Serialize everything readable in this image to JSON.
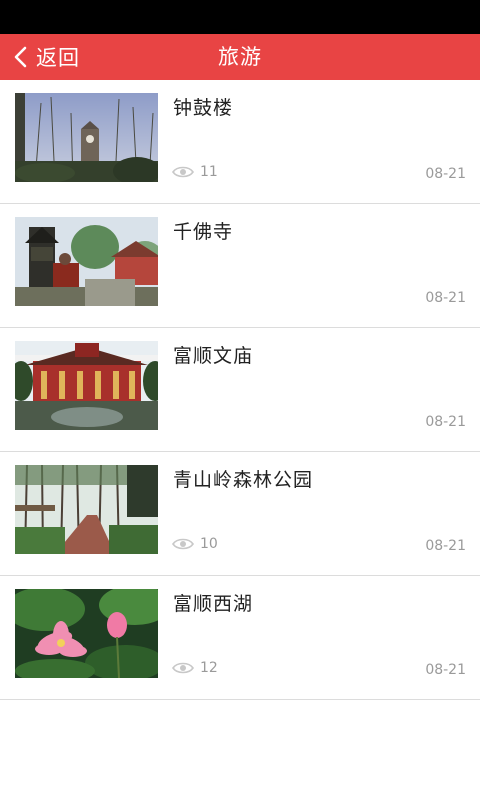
{
  "header": {
    "back_label": "返回",
    "title": "旅游",
    "accent_color": "#e84444"
  },
  "items": [
    {
      "title": "钟鼓楼",
      "views": "11",
      "date": "08-21",
      "image": "clock-tower-photo"
    },
    {
      "title": "千佛寺",
      "views": "",
      "date": "08-21",
      "image": "temple-incense-photo"
    },
    {
      "title": "富顺文庙",
      "views": "",
      "date": "08-21",
      "image": "confucius-temple-photo"
    },
    {
      "title": "青山岭森林公园",
      "views": "10",
      "date": "08-21",
      "image": "forest-path-photo"
    },
    {
      "title": "富顺西湖",
      "views": "12",
      "date": "08-21",
      "image": "lotus-flower-photo"
    }
  ]
}
